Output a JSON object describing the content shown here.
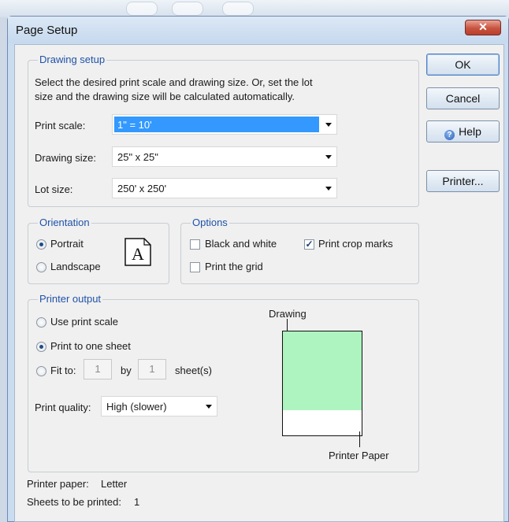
{
  "window": {
    "title": "Page Setup",
    "close_glyph": "✕"
  },
  "buttons": {
    "ok": "OK",
    "cancel": "Cancel",
    "help": "Help",
    "printer": "Printer..."
  },
  "drawing_setup": {
    "legend": "Drawing setup",
    "description_line1": "Select the desired print scale and drawing size. Or, set the lot",
    "description_line2": "size and the drawing size will be calculated automatically.",
    "print_scale_label": "Print scale:",
    "print_scale_value": "1\" = 10'",
    "drawing_size_label": "Drawing size:",
    "drawing_size_value": "25\" x 25\"",
    "lot_size_label": "Lot size:",
    "lot_size_value": "250' x 250'"
  },
  "orientation": {
    "legend": "Orientation",
    "portrait": "Portrait",
    "landscape": "Landscape",
    "selected": "portrait",
    "icon_letter": "A"
  },
  "options": {
    "legend": "Options",
    "black_and_white": {
      "label": "Black and white",
      "checked": false
    },
    "print_crop_marks": {
      "label": "Print crop marks",
      "checked": true
    },
    "print_the_grid": {
      "label": "Print the grid",
      "checked": false
    }
  },
  "printer_output": {
    "legend": "Printer output",
    "use_print_scale": "Use print scale",
    "print_to_one_sheet": "Print to one sheet",
    "fit_to": "Fit to:",
    "fit_to_x": "1",
    "by": "by",
    "fit_to_y": "1",
    "sheets": "sheet(s)",
    "selected": "print_to_one_sheet",
    "print_quality_label": "Print quality:",
    "print_quality_value": "High (slower)",
    "preview": {
      "drawing_label": "Drawing",
      "paper_label": "Printer Paper",
      "drawing_fill_fraction": 0.76,
      "drawing_color": "#adf4c0"
    }
  },
  "status": {
    "printer_paper_label": "Printer paper:",
    "printer_paper_value": "Letter",
    "sheets_label": "Sheets to be printed:",
    "sheets_value": "1"
  },
  "colors": {
    "legend_text": "#1f52a8",
    "selection": "#3399ff"
  }
}
